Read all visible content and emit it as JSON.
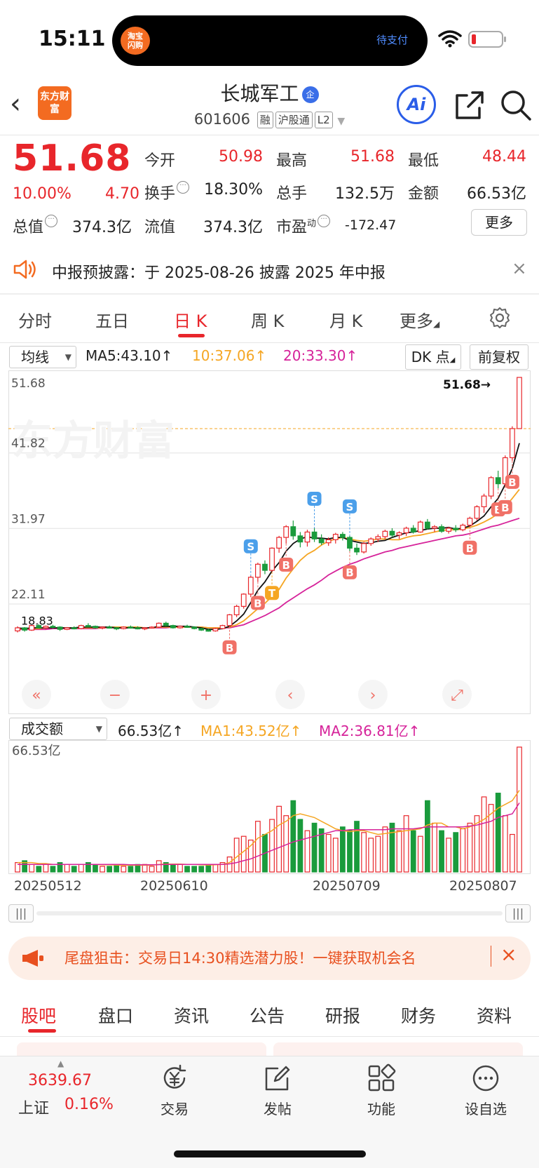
{
  "status": {
    "time": "15:11",
    "island_badge": "淘宝\n闪购",
    "island_text": "待支付"
  },
  "header": {
    "logo_text": "东方财富",
    "stock_name": "长城军工",
    "company_tag": "企",
    "code": "601606",
    "tags": [
      "融",
      "沪股通",
      "L2"
    ],
    "ai_label": "Ai"
  },
  "quote": {
    "price": "51.68",
    "change_pct": "10.00%",
    "change": "4.70",
    "open_label": "今开",
    "open": "50.98",
    "high_label": "最高",
    "high": "51.68",
    "low_label": "最低",
    "low": "48.44",
    "turnover_label": "换手",
    "turnover": "18.30%",
    "volume_label": "总手",
    "volume": "132.5万",
    "amount_label": "金额",
    "amount": "66.53亿",
    "mktcap_label": "总值",
    "mktcap": "374.3亿",
    "float_label": "流值",
    "float": "374.3亿",
    "pe_label": "市盈",
    "pe_sup": "动",
    "pe": "-172.47",
    "more_label": "更多"
  },
  "notice": {
    "text": "中报预披露：于 2025-08-26 披露 2025 年中报"
  },
  "period_tabs": [
    "分时",
    "五日",
    "日 K",
    "周 K",
    "月 K",
    "更多"
  ],
  "active_period": 2,
  "chart_header": {
    "indicator": "均线",
    "ma5": "MA5:43.10↑",
    "ma10": "10:37.06↑",
    "ma20": "20:33.30↑",
    "dk_label": "DK 点",
    "adjust_label": "前复权"
  },
  "volume_header": {
    "indicator": "成交额",
    "amount": "66.53亿↑",
    "ma1": "MA1:43.52亿↑",
    "ma2": "MA2:36.81亿↑",
    "axis_max": "66.53亿"
  },
  "colors": {
    "up": "#e8262b",
    "down": "#1a9b3c",
    "ma5": "#111111",
    "ma10": "#f5a623",
    "ma20": "#d6239a",
    "brand": "#f36b21"
  },
  "chart_data": {
    "type": "candlestick",
    "price_axis": [
      "51.68",
      "41.82",
      "31.97",
      "22.11"
    ],
    "x_labels": [
      "20250512",
      "20250610",
      "20250709",
      "20250807"
    ],
    "last_price_marker": "51.68→",
    "low_marker": "18.83",
    "candles": [
      [
        18.6,
        19.2,
        18.4,
        19.0
      ],
      [
        19.0,
        19.1,
        18.5,
        18.7
      ],
      [
        18.7,
        19.4,
        18.6,
        19.3
      ],
      [
        19.3,
        19.5,
        18.9,
        19.0
      ],
      [
        19.0,
        19.3,
        18.8,
        19.2
      ],
      [
        19.2,
        19.4,
        18.9,
        19.1
      ],
      [
        19.1,
        19.2,
        18.6,
        18.8
      ],
      [
        18.8,
        19.1,
        18.7,
        19.0
      ],
      [
        19.0,
        19.2,
        18.8,
        18.9
      ],
      [
        18.9,
        19.4,
        18.8,
        19.3
      ],
      [
        19.3,
        19.6,
        19.1,
        19.2
      ],
      [
        19.2,
        19.3,
        18.9,
        19.0
      ],
      [
        19.0,
        19.2,
        18.8,
        19.1
      ],
      [
        19.1,
        19.3,
        18.9,
        19.0
      ],
      [
        19.0,
        19.1,
        18.7,
        18.9
      ],
      [
        18.9,
        19.2,
        18.8,
        19.1
      ],
      [
        19.1,
        19.3,
        18.9,
        19.0
      ],
      [
        19.0,
        19.2,
        18.8,
        18.9
      ],
      [
        18.9,
        19.1,
        18.7,
        19.0
      ],
      [
        19.0,
        19.2,
        18.9,
        19.1
      ],
      [
        19.1,
        19.7,
        19.0,
        19.6
      ],
      [
        19.6,
        19.8,
        19.2,
        19.3
      ],
      [
        19.3,
        19.4,
        18.9,
        19.0
      ],
      [
        19.0,
        19.3,
        18.9,
        19.2
      ],
      [
        19.2,
        19.4,
        19.0,
        19.1
      ],
      [
        19.1,
        19.2,
        18.8,
        18.9
      ],
      [
        18.9,
        19.0,
        18.6,
        18.7
      ],
      [
        18.7,
        18.9,
        18.5,
        18.6
      ],
      [
        18.6,
        19.0,
        18.5,
        18.9
      ],
      [
        18.9,
        19.4,
        18.8,
        19.3
      ],
      [
        19.3,
        20.8,
        19.2,
        20.7
      ],
      [
        20.7,
        22.0,
        20.4,
        21.8
      ],
      [
        21.8,
        23.5,
        21.5,
        23.4
      ],
      [
        23.4,
        25.8,
        23.0,
        25.6
      ],
      [
        25.6,
        27.5,
        25.0,
        27.3
      ],
      [
        27.3,
        27.8,
        26.0,
        26.5
      ],
      [
        26.5,
        29.5,
        26.3,
        29.4
      ],
      [
        29.4,
        31.0,
        28.8,
        30.8
      ],
      [
        30.8,
        32.4,
        30.0,
        32.2
      ],
      [
        32.2,
        33.0,
        30.5,
        31.0
      ],
      [
        31.0,
        31.5,
        29.5,
        30.2
      ],
      [
        30.2,
        31.8,
        29.6,
        31.5
      ],
      [
        31.5,
        32.0,
        30.2,
        30.6
      ],
      [
        30.6,
        31.2,
        29.8,
        30.1
      ],
      [
        30.1,
        30.8,
        29.7,
        30.5
      ],
      [
        30.5,
        31.4,
        30.0,
        31.2
      ],
      [
        31.2,
        31.5,
        30.4,
        30.8
      ],
      [
        30.8,
        31.0,
        29.0,
        29.4
      ],
      [
        29.4,
        30.0,
        28.5,
        28.9
      ],
      [
        28.9,
        30.2,
        28.7,
        30.0
      ],
      [
        30.0,
        30.8,
        29.7,
        30.6
      ],
      [
        30.6,
        31.2,
        30.2,
        30.9
      ],
      [
        30.9,
        31.8,
        30.6,
        31.6
      ],
      [
        31.6,
        32.0,
        30.8,
        31.1
      ],
      [
        31.1,
        31.6,
        30.6,
        31.4
      ],
      [
        31.4,
        32.2,
        31.0,
        32.0
      ],
      [
        32.0,
        32.4,
        31.3,
        31.5
      ],
      [
        31.5,
        33.0,
        31.4,
        32.8
      ],
      [
        32.8,
        33.2,
        31.8,
        32.0
      ],
      [
        32.0,
        32.4,
        31.5,
        32.2
      ],
      [
        32.2,
        32.5,
        31.4,
        31.6
      ],
      [
        31.6,
        32.2,
        31.3,
        32.0
      ],
      [
        32.0,
        32.4,
        31.5,
        31.8
      ],
      [
        31.8,
        32.6,
        31.6,
        32.4
      ],
      [
        32.4,
        33.5,
        32.2,
        33.3
      ],
      [
        33.3,
        35.0,
        33.0,
        34.8
      ],
      [
        34.8,
        36.5,
        34.0,
        36.2
      ],
      [
        36.2,
        38.8,
        35.8,
        38.6
      ],
      [
        38.6,
        39.5,
        37.2,
        37.8
      ],
      [
        37.8,
        41.5,
        37.5,
        41.2
      ],
      [
        41.2,
        45.3,
        40.8,
        45.0
      ],
      [
        45.0,
        51.68,
        48.44,
        51.68
      ]
    ],
    "ma5": [
      19.0,
      18.9,
      19.0,
      19.0,
      19.0,
      19.0,
      19.0,
      19.0,
      19.0,
      19.1,
      19.1,
      19.1,
      19.1,
      19.1,
      19.0,
      19.0,
      19.0,
      19.0,
      19.0,
      19.0,
      19.2,
      19.2,
      19.2,
      19.2,
      19.2,
      19.1,
      19.0,
      18.8,
      18.8,
      18.9,
      19.2,
      19.9,
      20.8,
      22.3,
      23.9,
      25.0,
      26.4,
      27.5,
      29.0,
      30.0,
      30.6,
      30.9,
      30.7,
      30.7,
      30.6,
      30.8,
      30.8,
      30.4,
      30.2,
      30.0,
      30.1,
      30.3,
      30.4,
      30.8,
      31.1,
      31.4,
      31.5,
      31.7,
      31.9,
      32.0,
      32.0,
      32.1,
      31.9,
      32.0,
      32.3,
      32.9,
      33.6,
      34.8,
      35.9,
      37.7,
      39.8,
      43.1
    ],
    "ma10": [
      18.9,
      18.9,
      18.9,
      18.9,
      19.0,
      19.0,
      19.0,
      19.0,
      19.0,
      19.0,
      19.0,
      19.0,
      19.0,
      19.1,
      19.1,
      19.1,
      19.1,
      19.1,
      19.0,
      19.0,
      19.1,
      19.1,
      19.1,
      19.1,
      19.1,
      19.1,
      19.1,
      19.0,
      19.0,
      19.0,
      19.1,
      19.4,
      19.9,
      20.7,
      21.5,
      22.2,
      23.1,
      24.0,
      25.5,
      26.7,
      27.8,
      28.6,
      29.1,
      29.8,
      30.3,
      30.6,
      30.8,
      30.6,
      30.4,
      30.3,
      30.4,
      30.6,
      30.6,
      30.5,
      30.5,
      30.8,
      31.0,
      31.1,
      31.3,
      31.5,
      31.7,
      31.8,
      31.8,
      31.9,
      32.1,
      32.4,
      32.8,
      33.3,
      33.9,
      34.8,
      35.9,
      37.06
    ],
    "ma20": [
      18.8,
      18.8,
      18.8,
      18.8,
      18.8,
      18.9,
      18.9,
      18.9,
      18.9,
      18.9,
      18.9,
      18.9,
      19.0,
      19.0,
      19.0,
      19.0,
      19.0,
      19.0,
      19.0,
      19.0,
      19.0,
      19.0,
      19.1,
      19.1,
      19.1,
      19.1,
      19.1,
      19.0,
      19.0,
      19.0,
      19.0,
      19.2,
      19.4,
      19.8,
      20.2,
      20.6,
      21.1,
      21.6,
      22.3,
      22.9,
      23.5,
      24.1,
      24.6,
      25.2,
      25.9,
      26.4,
      26.9,
      27.3,
      27.6,
      28.0,
      28.3,
      28.6,
      28.9,
      29.1,
      29.4,
      29.6,
      29.8,
      30.0,
      30.2,
      30.4,
      30.6,
      30.8,
      31.0,
      31.1,
      31.3,
      31.6,
      31.9,
      32.2,
      32.4,
      32.7,
      33.0,
      33.3
    ],
    "volume": [
      5,
      6,
      4,
      3,
      4,
      3,
      5,
      4,
      3,
      4,
      5,
      4,
      3,
      3,
      4,
      3,
      3,
      4,
      4,
      3,
      6,
      5,
      4,
      4,
      3,
      3,
      3,
      4,
      4,
      5,
      8,
      18,
      19,
      17,
      27,
      20,
      28,
      35,
      30,
      38,
      28,
      22,
      26,
      23,
      20,
      18,
      24,
      22,
      27,
      21,
      18,
      19,
      24,
      26,
      22,
      30,
      22,
      19,
      38,
      26,
      22,
      18,
      21,
      23,
      26,
      30,
      40,
      36,
      42,
      30,
      20,
      66.53
    ],
    "volume_ma1": [
      5,
      5,
      5,
      4.5,
      4.5,
      4,
      4,
      4,
      4,
      4,
      4,
      4,
      3.8,
      3.8,
      3.7,
      3.6,
      3.6,
      3.6,
      3.6,
      3.6,
      4,
      4.2,
      4.2,
      4.2,
      4,
      4,
      3.8,
      3.7,
      3.8,
      4,
      5,
      8,
      11,
      14,
      18,
      20,
      22,
      25,
      27,
      30,
      31,
      30,
      29,
      27,
      25,
      23,
      22,
      21.5,
      22,
      22,
      21,
      20,
      20.5,
      21,
      21.5,
      22,
      22.5,
      23,
      25,
      26,
      26,
      24,
      24,
      23,
      24,
      26,
      28,
      31,
      34,
      36,
      38,
      43.52
    ],
    "volume_ma2": [
      4,
      4,
      4,
      4,
      4,
      4,
      4,
      4,
      4,
      4,
      4,
      4,
      4,
      4,
      4,
      4,
      3.8,
      3.8,
      3.8,
      3.8,
      3.9,
      4,
      4,
      4,
      4,
      4,
      4,
      4,
      4,
      4,
      4.3,
      5,
      6,
      7,
      8.5,
      10,
      11.5,
      13,
      14.5,
      16,
      17,
      18,
      19,
      20,
      21,
      22,
      22,
      22.5,
      22.5,
      22.5,
      22.5,
      22.5,
      22.5,
      23,
      23,
      23,
      23,
      23.5,
      24,
      24,
      24,
      24,
      24,
      24,
      24.5,
      25,
      26,
      27,
      29,
      30,
      31,
      36.81
    ]
  },
  "banner": {
    "text": "尾盘狙击：交易日14:30精选潜力股！一键获取机会名"
  },
  "section_tabs": [
    "股吧",
    "盘口",
    "资讯",
    "公告",
    "研报",
    "财务",
    "资料"
  ],
  "bottom_nav": {
    "index_value": "3639.67",
    "index_name": "上证",
    "index_pct": "0.16%",
    "items": [
      "交易",
      "发帖",
      "功能",
      "设自选"
    ]
  }
}
